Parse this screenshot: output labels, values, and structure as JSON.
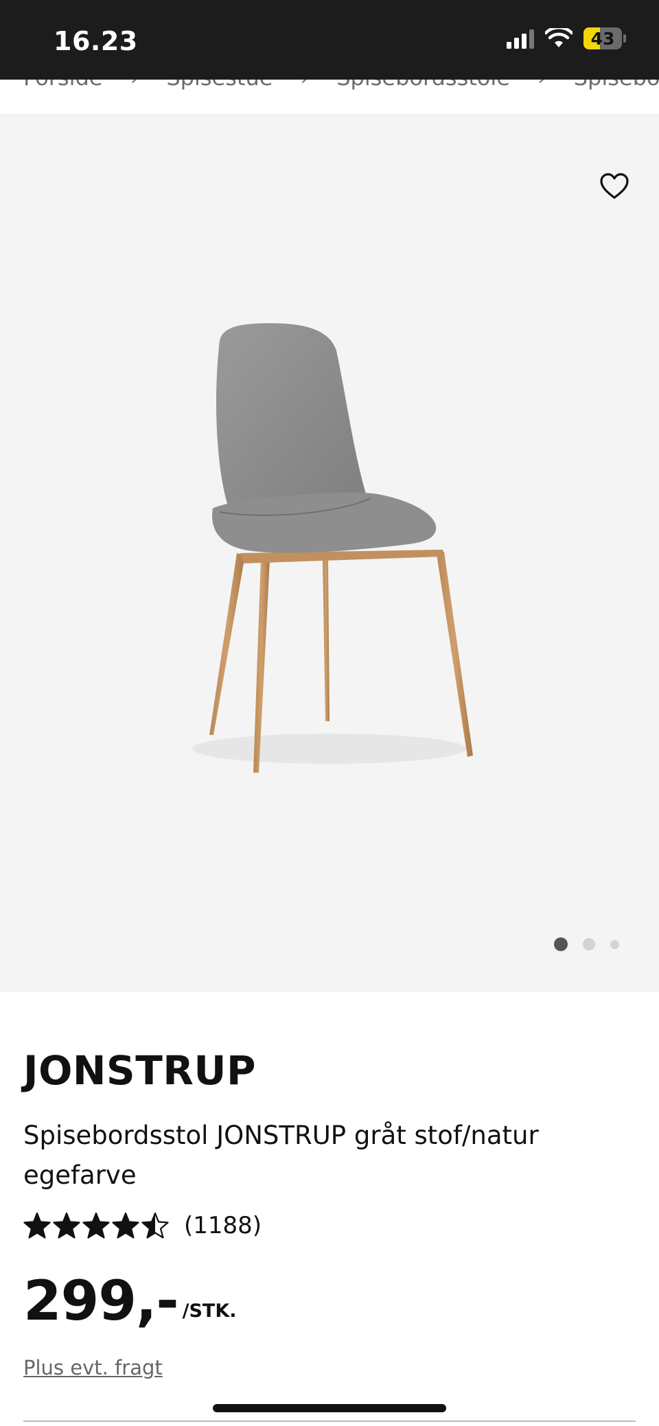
{
  "status_bar": {
    "time": "16.23",
    "battery_level": "43",
    "battery_fraction": 0.43,
    "icons": [
      "signal-icon",
      "wifi-icon",
      "battery-icon"
    ]
  },
  "breadcrumb": {
    "items": [
      "Forside",
      "Spisestue",
      "Spisebordsstole",
      "Spisebordsstol JON"
    ]
  },
  "gallery": {
    "favorite_icon": "heart-outline-icon",
    "image_count": 3,
    "active_index": 0
  },
  "product": {
    "brand": "JONSTRUP",
    "description": "Spisebordsstol JONSTRUP gråt stof/natur egefarve",
    "rating": 4.5,
    "review_count": "(1188)",
    "price": "299,-",
    "price_unit": "/STK.",
    "shipping_link": "Plus evt. fragt"
  },
  "colors": {
    "status_bar_bg": "#1c1c1c",
    "gallery_bg": "#f4f4f4",
    "battery_accent": "#f5d60a",
    "text": "#111111"
  }
}
